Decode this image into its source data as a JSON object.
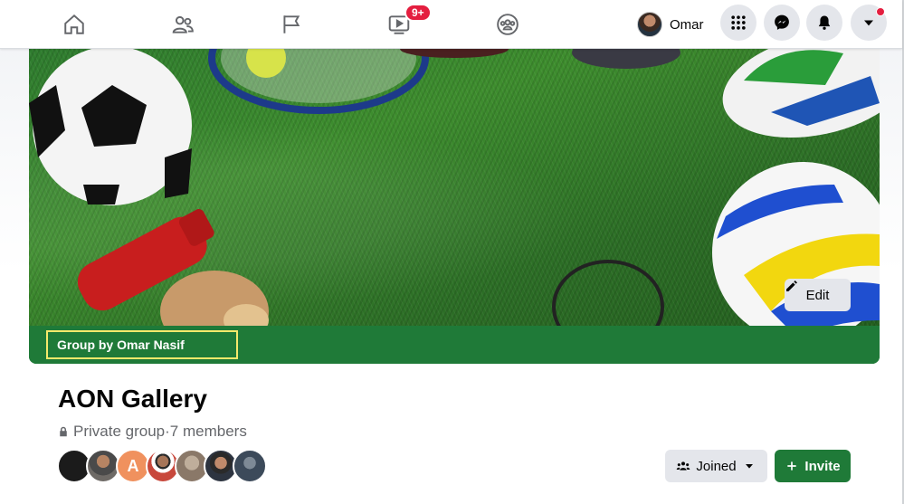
{
  "nav": {
    "icons": [
      "home-icon",
      "friends-icon",
      "pages-flag-icon",
      "watch-video-icon",
      "groups-icon"
    ],
    "watch_badge": "9+",
    "profile_name": "Omar",
    "right_buttons": [
      "menu-grid-icon",
      "messenger-icon",
      "notifications-bell-icon",
      "account-caret-icon"
    ]
  },
  "cover": {
    "edit_label": "Edit",
    "group_by": "Group by Omar Nasif",
    "accent_color": "#1f7a38",
    "highlight_color": "#f5e96b"
  },
  "group": {
    "title": "AON Gallery",
    "privacy": "Private group",
    "separator": " · ",
    "members": "7 members",
    "member_avatars": [
      {
        "letter": "",
        "color": "#1b1b1b"
      },
      {
        "letter": "",
        "color": "#5a5550"
      },
      {
        "letter": "A",
        "color": "#f0915e"
      },
      {
        "letter": "",
        "color": "#c8483c"
      },
      {
        "letter": "",
        "color": "#9c8a7a"
      },
      {
        "letter": "",
        "color": "#2d3440"
      },
      {
        "letter": "",
        "color": "#3c4a5a"
      }
    ],
    "joined_label": "Joined",
    "invite_label": "Invite"
  }
}
